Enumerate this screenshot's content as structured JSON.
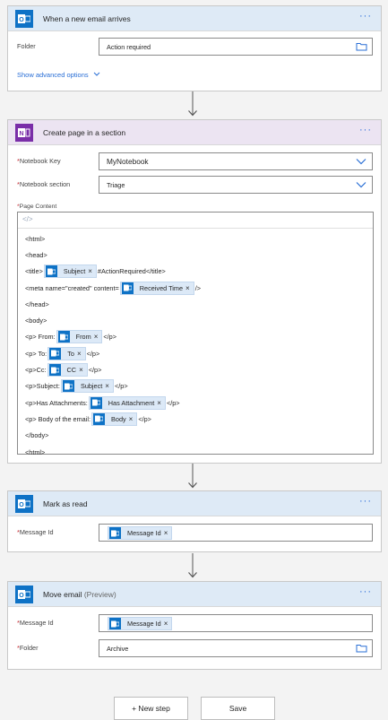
{
  "trigger": {
    "title": "When a new email arrives",
    "folder_label": "Folder",
    "folder_value": "Action required",
    "advanced_link": "Show advanced options"
  },
  "onenote": {
    "title": "Create page in a section",
    "notebook_key_label": "Notebook Key",
    "notebook_key_value": "MyNotebook",
    "notebook_section_label": "Notebook section",
    "notebook_section_value": "Triage",
    "page_content_label": "Page Content",
    "editor_toolbar": "</>",
    "lines": [
      {
        "pre": "<html>"
      },
      {
        "pre": "<head>"
      },
      {
        "pre": "<title>",
        "token": "Subject",
        "post": " #ActionRequired</title>"
      },
      {
        "pre": "<meta name=\"created\" content=",
        "token": "Received Time",
        "post": " />"
      },
      {
        "pre": "</head>"
      },
      {
        "pre": "<body>"
      },
      {
        "pre": "<p> From:",
        "token": "From",
        "post": " </p>"
      },
      {
        "pre": "<p> To:",
        "token": "To",
        "post": " </p>"
      },
      {
        "pre": "<p>Cc:",
        "token": "CC",
        "post": " </p>"
      },
      {
        "pre": "<p>Subject:",
        "token": "Subject",
        "post": " </p>"
      },
      {
        "pre": "<p>Has Attachments:",
        "token": "Has Attachment",
        "post": " </p>"
      },
      {
        "pre": "<p> Body of the email:",
        "token": "Body",
        "post": " </p>"
      },
      {
        "pre": "</body>"
      },
      {
        "pre": "<html>"
      }
    ]
  },
  "mark_read": {
    "title": "Mark as read",
    "message_id_label": "Message Id",
    "message_id_token": "Message Id"
  },
  "move_email": {
    "title": "Move email",
    "title_suffix": "(Preview)",
    "message_id_label": "Message Id",
    "message_id_token": "Message Id",
    "folder_label": "Folder",
    "folder_value": "Archive"
  },
  "footer": {
    "new_step": "+ New step",
    "save": "Save"
  },
  "required_marker": "*",
  "more_dots": "···",
  "token_remove": "×",
  "colors": {
    "outlook_blue": "#0e72c6",
    "onenote_purple": "#7a2ea8",
    "link_blue": "#2a6fd6",
    "required_red": "#c4262e"
  },
  "icons": [
    "outlook-icon",
    "onenote-icon",
    "folder-icon",
    "chevron-down-icon",
    "code-view-icon",
    "arrow-down-icon",
    "ellipsis-icon",
    "remove-token-icon"
  ]
}
